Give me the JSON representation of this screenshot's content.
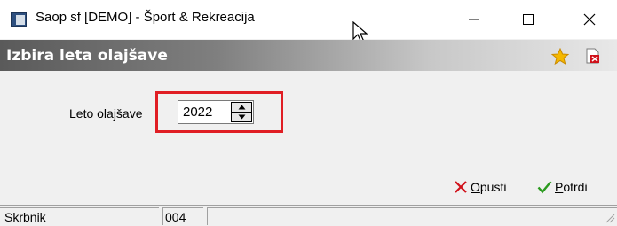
{
  "window": {
    "title": "Saop sf [DEMO] - Šport & Rekreacija",
    "icon": "app-window-icon"
  },
  "header": {
    "title": "Izbira leta olajšave",
    "icons": [
      "star-icon",
      "close-document-icon"
    ]
  },
  "form": {
    "year_label": "Leto olajšave",
    "year_value": "2022"
  },
  "buttons": {
    "cancel_label": "Opusti",
    "confirm_label": "Potrdi"
  },
  "statusbar": {
    "user_label": "Skrbnik",
    "code": "004",
    "extra": ""
  },
  "colors": {
    "highlight": "#e01e24",
    "cancel_icon": "#d0121b",
    "confirm_icon": "#2a9a1e",
    "star": "#f5b800"
  }
}
